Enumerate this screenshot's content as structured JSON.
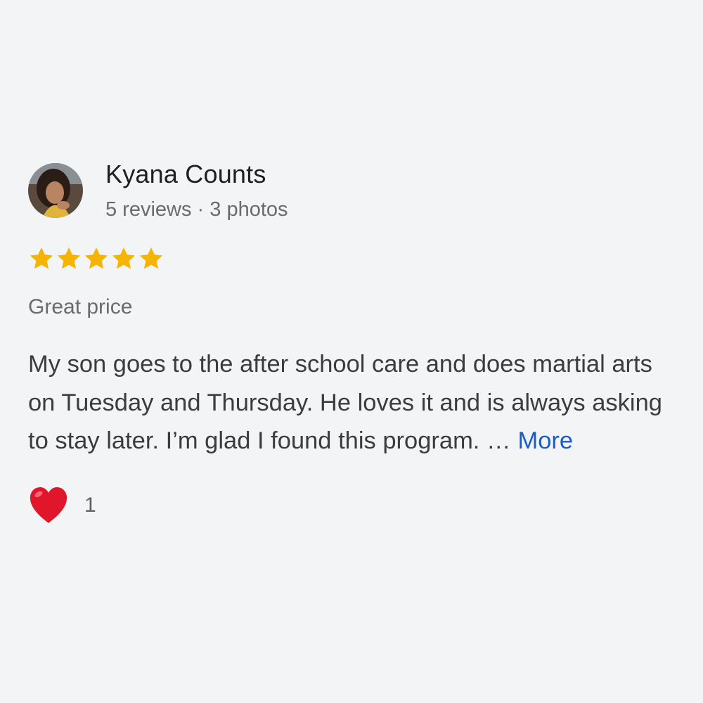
{
  "review": {
    "author_name": "Kyana Counts",
    "author_meta": "5 reviews · 3 photos",
    "rating": 5,
    "rating_max": 5,
    "star_color": "#f6b400",
    "title": "Great price",
    "body": "My son goes to the after school care and does martial arts on Tuesday and Thursday. He loves it and is always asking to stay later. I’m glad I found this program. …",
    "more_label": "More",
    "reaction_icon": "heart-icon",
    "reaction_color": "#e0162b",
    "reaction_count": "1"
  }
}
